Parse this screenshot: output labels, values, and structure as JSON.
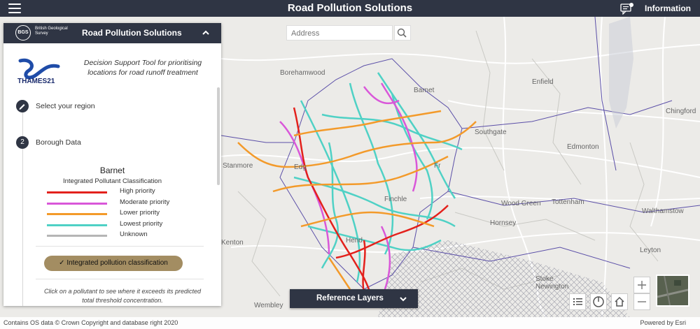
{
  "app": {
    "title": "Road Pollution Solutions",
    "info_label": "Information"
  },
  "panel": {
    "title": "Road Pollution Solutions",
    "bgs_logo_text": "BGS",
    "bgs_name": "British Geological Survey",
    "partner_logo_text": "THAMES21",
    "tagline": "Decision Support Tool for prioritising locations for road runoff treatment",
    "step1": {
      "label": "Select your region"
    },
    "step2": {
      "number": "2",
      "label": "Borough Data"
    },
    "region": "Barnet",
    "classification_title": "Integrated Pollutant Classification",
    "legend": [
      {
        "label": "High priority",
        "color": "#e3211c"
      },
      {
        "label": "Moderate priority",
        "color": "#d957d9"
      },
      {
        "label": "Lower priority",
        "color": "#f39a2a"
      },
      {
        "label": "Lowest priority",
        "color": "#4fd1c5"
      },
      {
        "label": "Unknown",
        "color": "#b5b5b5"
      }
    ],
    "active_button": "Integrated pollution classification",
    "hint": "Click on a pollutant to see where it exceeds its predicted total threshold concentration."
  },
  "search": {
    "placeholder": "Address"
  },
  "reference_layers": {
    "label": "Reference Layers"
  },
  "map_labels": {
    "borehamwood": "Borehamwood",
    "barnet": "Barnet",
    "enfield": "Enfield",
    "southgate": "Southgate",
    "edmonton": "Edmonton",
    "stanmore": "Stanmore",
    "edgware": "Edg",
    "friern": "Fr",
    "finchley": "Finchle",
    "wood_green": "Wood Green",
    "hornsey": "Hornsey",
    "tottenham": "Tottenham",
    "walthamstow": "Walthamstow",
    "kenton": "Kenton",
    "hendon": "Hend",
    "wembley": "Wembley",
    "stoke_newington": "Stoke Newington",
    "leyton": "Leyton",
    "chingford": "Chingford"
  },
  "footer": {
    "credits": "Contains OS data © Crown Copyright and database right 2020",
    "powered": "Powered by Esri"
  }
}
